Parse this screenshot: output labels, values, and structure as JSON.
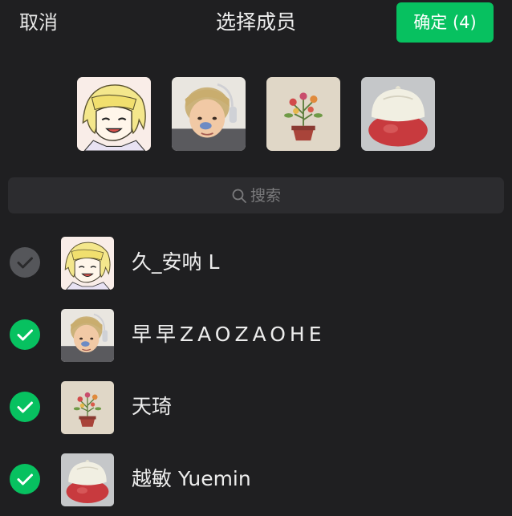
{
  "header": {
    "cancel_label": "取消",
    "title": "选择成员",
    "confirm_label": "确定 (4)"
  },
  "colors": {
    "background": "#1f1f21",
    "accent_green": "#07c160",
    "search_bg": "#2c2c2f",
    "unchecked_circle": "#55565a"
  },
  "selected_avatars": [
    {
      "icon": "anime-blond-avatar"
    },
    {
      "icon": "person-photo-avatar"
    },
    {
      "icon": "flower-painting-avatar"
    },
    {
      "icon": "steamed-bun-avatar"
    }
  ],
  "search": {
    "icon": "search-icon",
    "placeholder": "搜索"
  },
  "members": [
    {
      "name": "久_安呐 L",
      "checked": false,
      "icon": "anime-blond-avatar"
    },
    {
      "name": "早早ZAOZAOHE",
      "checked": true,
      "icon": "person-photo-avatar"
    },
    {
      "name": "天琦",
      "checked": true,
      "icon": "flower-painting-avatar"
    },
    {
      "name": "越敏 Yuemin",
      "checked": true,
      "icon": "steamed-bun-avatar"
    }
  ]
}
